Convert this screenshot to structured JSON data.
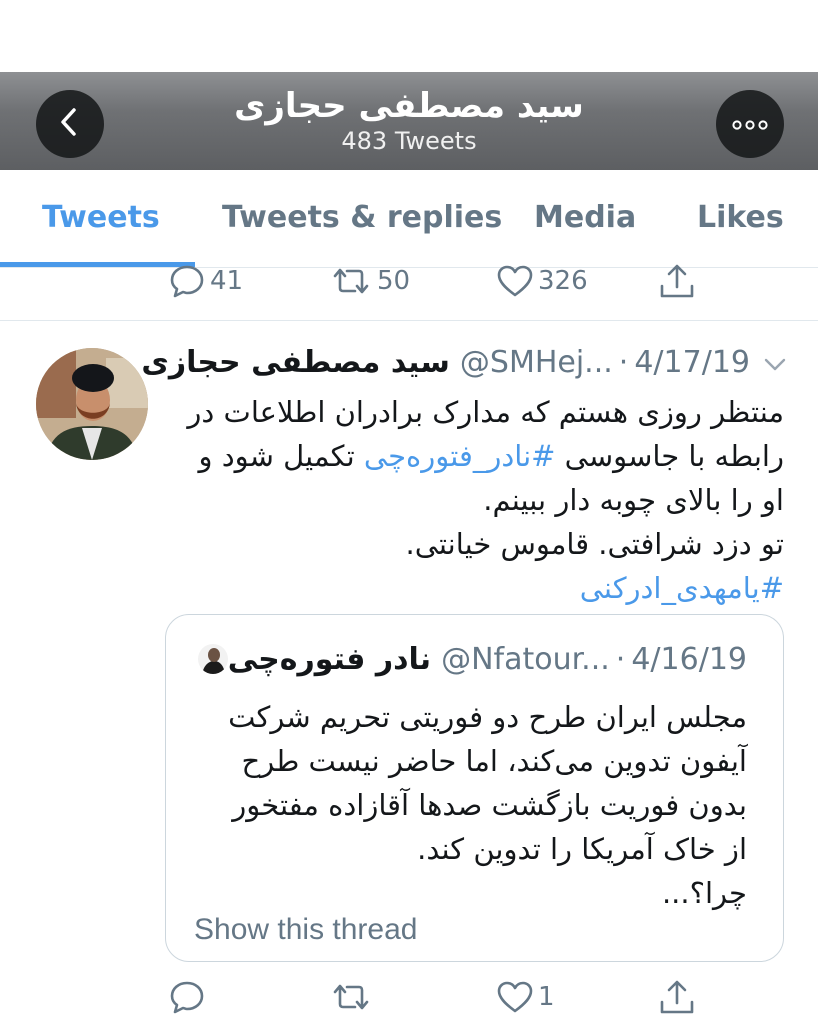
{
  "header": {
    "profile_name": "سید مصطفی حجازی",
    "tweet_count": "483 Tweets"
  },
  "tabs": [
    {
      "label": "Tweets",
      "active": true
    },
    {
      "label": "Tweets & replies",
      "active": false
    },
    {
      "label": "Media",
      "active": false
    },
    {
      "label": "Likes",
      "active": false
    }
  ],
  "previous_tweet_actions": {
    "replies": "41",
    "retweets": "50",
    "likes": "326"
  },
  "tweet": {
    "author_name": "سید مصطفی حجازی",
    "handle": "@SMHej...",
    "dot": "·",
    "date": "4/17/19",
    "lines": [
      {
        "pre": "منتظر روزی هستم که مدارک برادران اطلاعات در",
        "tag": "",
        "post": ""
      },
      {
        "pre": "رابطه با جاسوسی ",
        "tag": "#نادر_فتوره‌چی",
        "post": " تکمیل شود و"
      },
      {
        "pre": "او را بالای چوبه دار ببینم.",
        "tag": "",
        "post": ""
      },
      {
        "pre": "تو دزد شرافتی. قاموس خیانتی.",
        "tag": "",
        "post": ""
      },
      {
        "pre": "",
        "tag": "#یامهدی_ادرکنی",
        "post": ""
      }
    ],
    "actions": {
      "replies": "",
      "retweets": "",
      "likes": "1"
    }
  },
  "quoted_tweet": {
    "author_name": "نادر فتوره‌چی",
    "handle": "@Nfatour...",
    "dot": "·",
    "date": "4/16/19",
    "lines": [
      "مجلس ایران طرح دو فوریتی تحریم شرکت",
      "آیفون تدوین می‌کند، اما حاضر نیست طرح",
      "بدون فوریت بازگشت صدها آقازاده مفتخور",
      "از خاک آمریکا را تدوین کند.",
      "چرا؟..."
    ],
    "show_thread": "Show this thread"
  },
  "colors": {
    "accent": "#4a99e9",
    "secondary_text": "#657786",
    "border": "#e1e8ed"
  },
  "icons": [
    "back-chevron-icon",
    "more-dots-icon",
    "reply-icon",
    "retweet-icon",
    "like-heart-icon",
    "share-icon",
    "caret-down-icon"
  ]
}
